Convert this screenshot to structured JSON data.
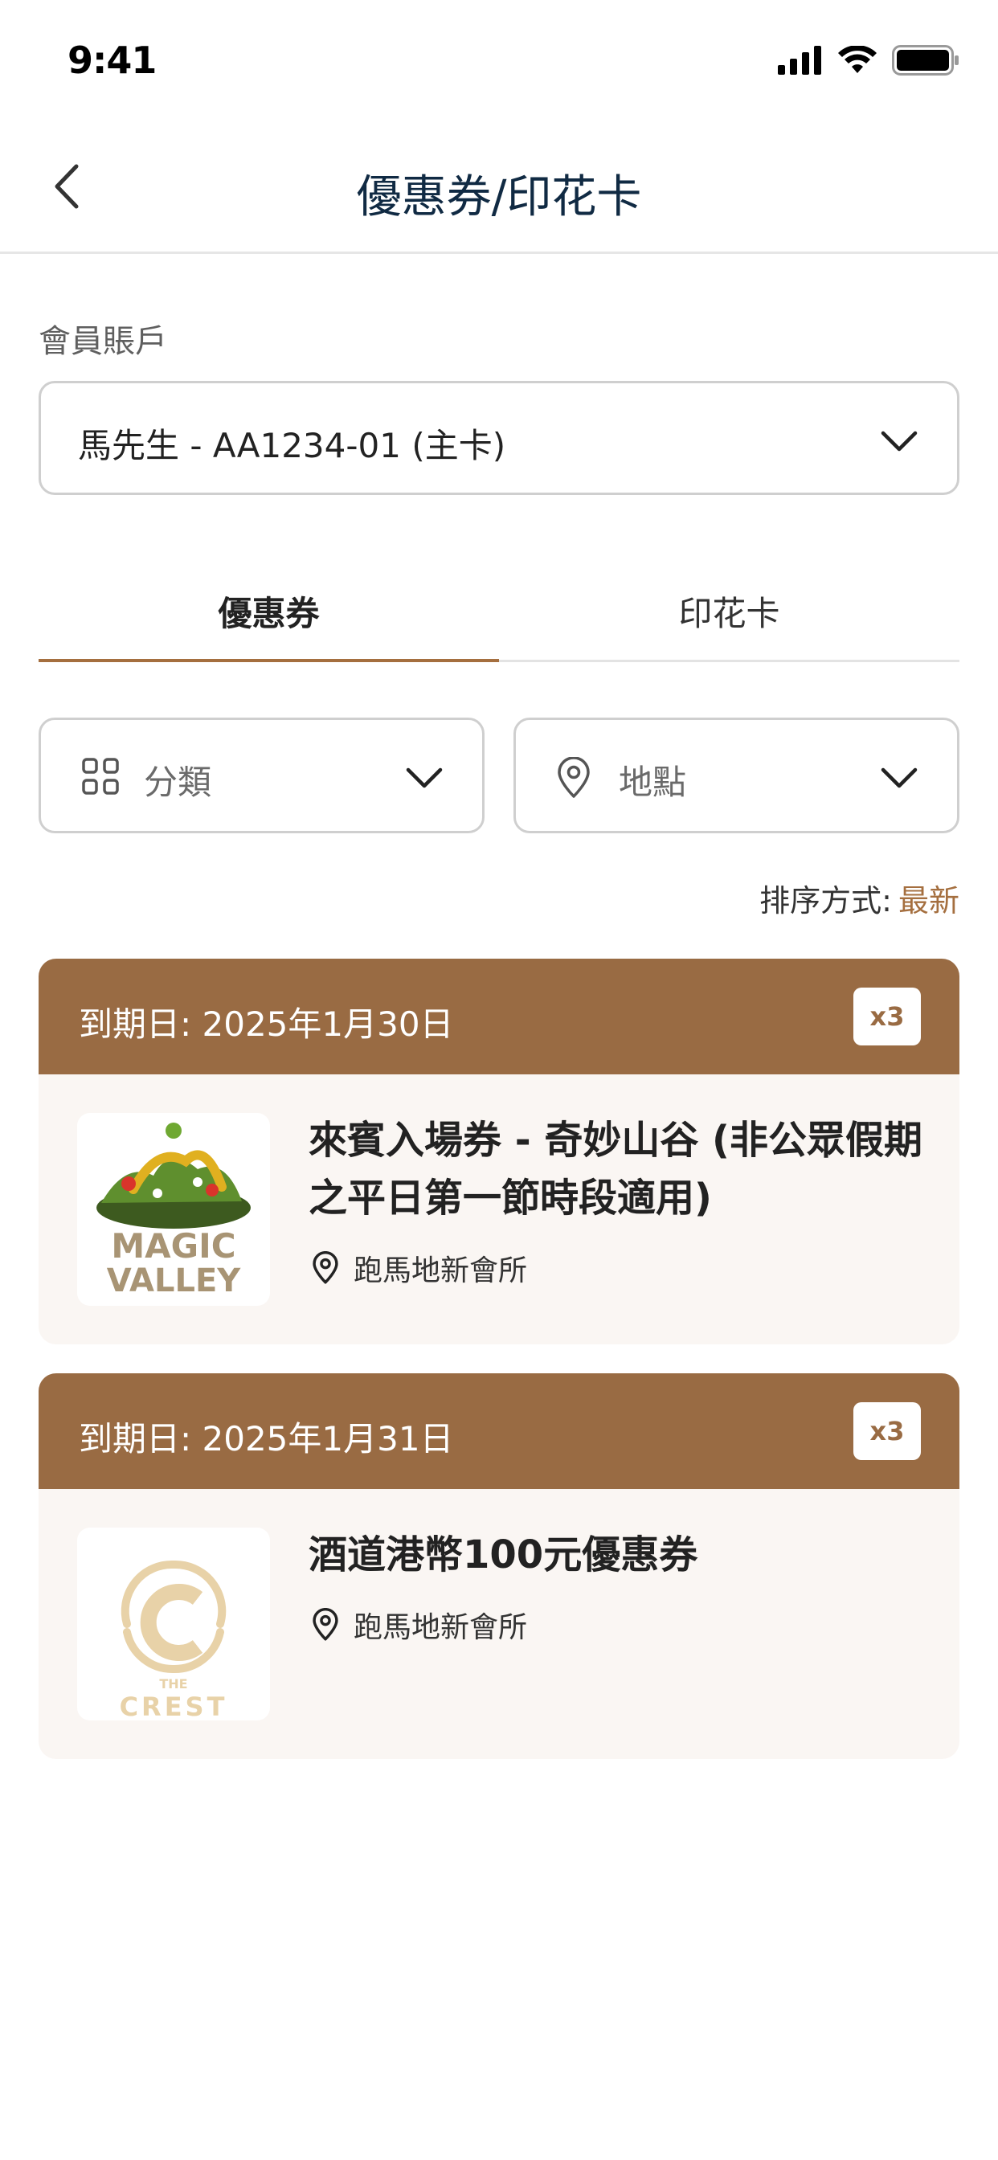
{
  "status_bar": {
    "time": "9:41"
  },
  "header": {
    "title": "優惠券/印花卡"
  },
  "account": {
    "label": "會員賬戶",
    "selected": "馬先生 - AA1234-01 (主卡)"
  },
  "tabs": [
    {
      "label": "優惠券",
      "active": true
    },
    {
      "label": "印花卡",
      "active": false
    }
  ],
  "filters": {
    "category": "分類",
    "location": "地點"
  },
  "sort": {
    "label": "排序方式:",
    "value": "最新"
  },
  "coupons": [
    {
      "expiry": "到期日: 2025年1月30日",
      "quantity": "x3",
      "title": "來賓入場券 - 奇妙山谷 (非公眾假期之平日第一節時段適用)",
      "location": "跑馬地新會所",
      "logo_text": [
        "MAGIC",
        "VALLEY"
      ]
    },
    {
      "expiry": "到期日: 2025年1月31日",
      "quantity": "x3",
      "title": "酒道港幣100元優惠券",
      "location": "跑馬地新會所",
      "logo_text": [
        "THE",
        "CREST"
      ]
    }
  ],
  "colors": {
    "accent": "#996b43",
    "tab_underline": "#a56f3f",
    "title": "#102a43",
    "card_bg": "#faf6f3"
  }
}
